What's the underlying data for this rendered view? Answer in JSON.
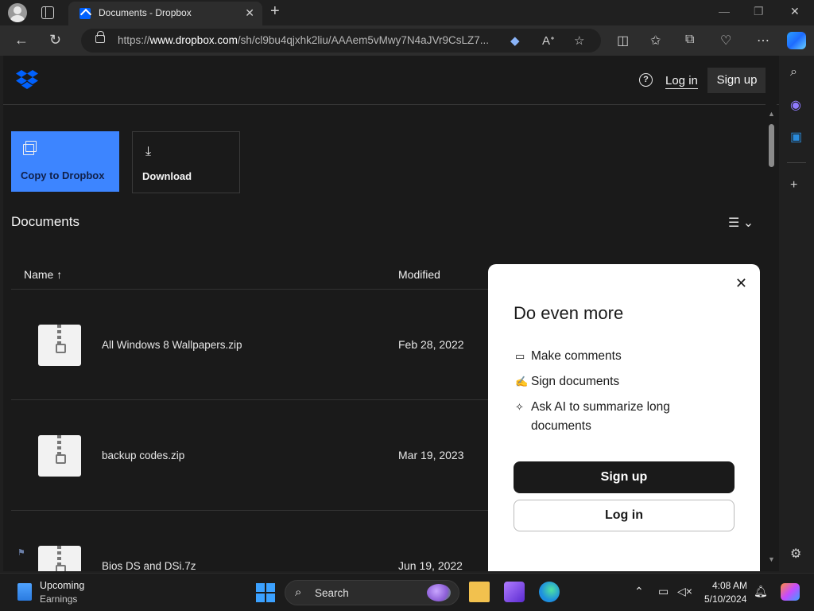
{
  "browser": {
    "tab_title": "Documents - Dropbox",
    "url_prefix": "https://",
    "url_host": "www.dropbox.com",
    "url_path": "/sh/cl9bu4qjxhk2liu/AAAem5vMwy7N4aJVr9CsLZ7..."
  },
  "header": {
    "login": "Log in",
    "signup": "Sign up"
  },
  "actions": {
    "copy": "Copy to Dropbox",
    "download": "Download"
  },
  "section_title": "Documents",
  "columns": {
    "name": "Name",
    "modified": "Modified"
  },
  "files": [
    {
      "name": "All Windows 8 Wallpapers.zip",
      "modified": "Feb 28, 2022"
    },
    {
      "name": "backup codes.zip",
      "modified": "Mar 19, 2023"
    },
    {
      "name": "Bios DS and DSi.7z",
      "modified": "Jun 19, 2022"
    }
  ],
  "modal": {
    "title": "Do even more",
    "features": [
      "Make comments",
      "Sign documents",
      "Ask AI to summarize long documents"
    ],
    "signup": "Sign up",
    "login": "Log in"
  },
  "taskbar": {
    "weather_title": "Upcoming",
    "weather_sub": "Earnings",
    "search": "Search",
    "time": "4:08 AM",
    "date": "5/10/2024"
  },
  "colors": {
    "accent": "#3d85ff",
    "dropbox_blue": "#0061fe"
  }
}
